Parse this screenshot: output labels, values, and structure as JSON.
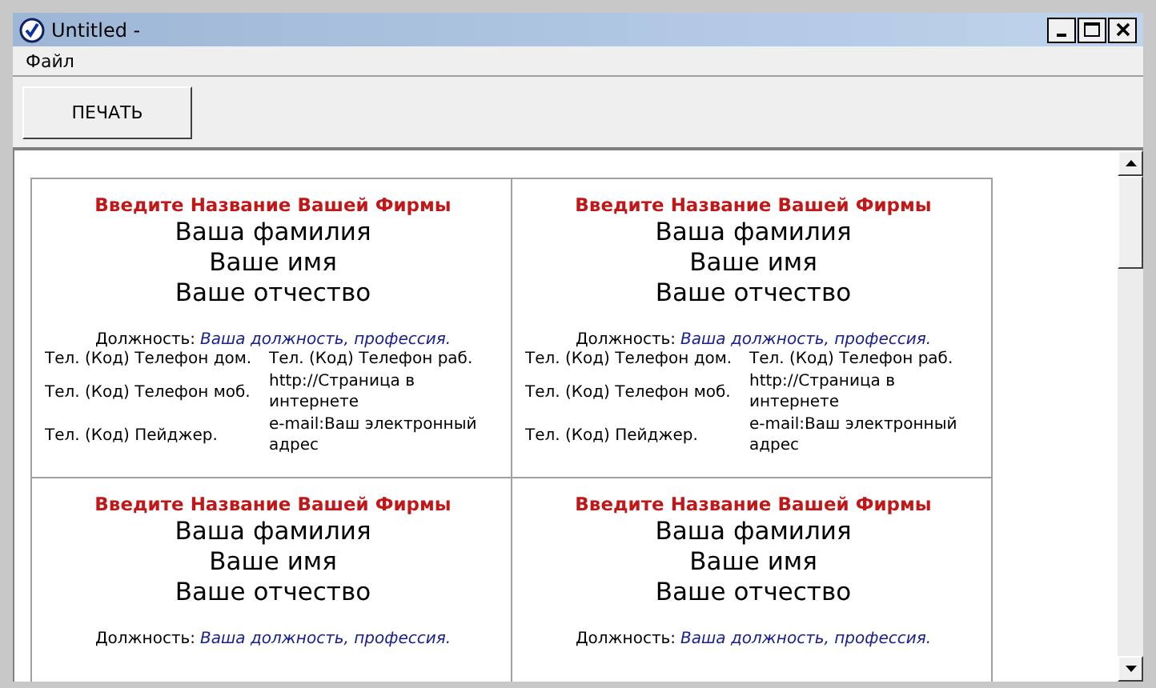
{
  "window": {
    "title": "Untitled -"
  },
  "menu": [
    {
      "label": "Файл"
    }
  ],
  "toolbar": {
    "buttons": [
      {
        "label": "ПЕЧАТЬ"
      }
    ]
  },
  "cards": [
    {
      "company": "Введите Название Вашей Фирмы",
      "surname": "Ваша фамилия",
      "name": "Ваше имя",
      "patronymic": "Ваше отчество",
      "position_label": "Должность:",
      "position_value": "Ваша должность, профессия.",
      "contacts": [
        [
          "Тел. (Код) Телефон дом.",
          "Тел. (Код) Телефон раб."
        ],
        [
          "Тел. (Код) Телефон моб.",
          "http://Страница в интернете"
        ],
        [
          "Тел. (Код) Пейджер.",
          "e-mail:Ваш электронный адрес"
        ]
      ]
    },
    {
      "company": "Введите Название Вашей Фирмы",
      "surname": "Ваша фамилия",
      "name": "Ваше имя",
      "patronymic": "Ваше отчество",
      "position_label": "Должность:",
      "position_value": "Ваша должность, профессия.",
      "contacts": [
        [
          "Тел. (Код) Телефон дом.",
          "Тел. (Код) Телефон раб."
        ],
        [
          "Тел. (Код) Телефон моб.",
          "http://Страница в интернете"
        ],
        [
          "Тел. (Код) Пейджер.",
          "e-mail:Ваш электронный адрес"
        ]
      ]
    },
    {
      "company": "Введите Название Вашей Фирмы",
      "surname": "Ваша фамилия",
      "name": "Ваше имя",
      "patronymic": "Ваше отчество",
      "position_label": "Должность:",
      "position_value": "Ваша должность, профессия."
    },
    {
      "company": "Введите Название Вашей Фирмы",
      "surname": "Ваша фамилия",
      "name": "Ваше имя",
      "patronymic": "Ваше отчество",
      "position_label": "Должность:",
      "position_value": "Ваша должность, профессия."
    }
  ]
}
